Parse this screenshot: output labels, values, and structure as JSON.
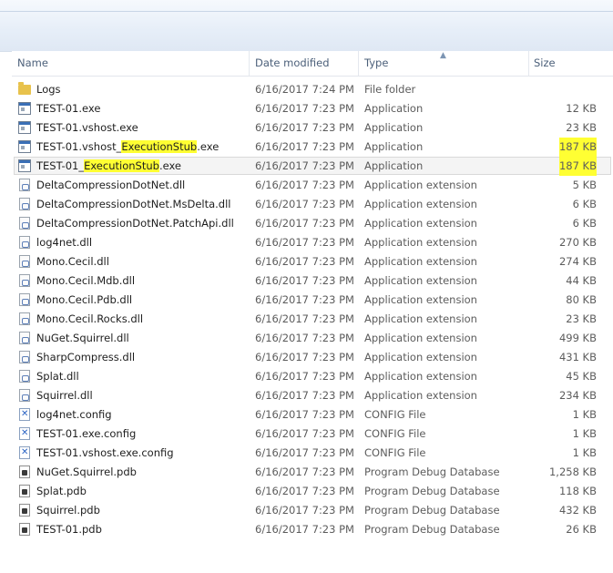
{
  "columns": {
    "name": "Name",
    "date_modified": "Date modified",
    "type": "Type",
    "size": "Size"
  },
  "sort": {
    "column": "type",
    "direction": "ascending"
  },
  "highlight_color": "#ffff33",
  "files": [
    {
      "icon": "folder-icon",
      "name": "Logs",
      "date": "6/16/2017 7:24 PM",
      "type": "File folder",
      "size": ""
    },
    {
      "icon": "application-icon",
      "name": "TEST-01.exe",
      "date": "6/16/2017 7:23 PM",
      "type": "Application",
      "size": "12 KB"
    },
    {
      "icon": "application-icon",
      "name": "TEST-01.vshost.exe",
      "date": "6/16/2017 7:23 PM",
      "type": "Application",
      "size": "23 KB"
    },
    {
      "icon": "application-icon",
      "name_pre": "TEST-01.vshost_",
      "name_hl": "ExecutionStub",
      "name_post": ".exe",
      "date": "6/16/2017 7:23 PM",
      "type": "Application",
      "size": "187 KB",
      "size_highlighted": true
    },
    {
      "icon": "application-icon",
      "name_pre": "TEST-01_",
      "name_hl": "ExecutionStub",
      "name_post": ".exe",
      "date": "6/16/2017 7:23 PM",
      "type": "Application",
      "size": "187 KB",
      "size_highlighted": true,
      "selected": true
    },
    {
      "icon": "dll-icon",
      "name": "DeltaCompressionDotNet.dll",
      "date": "6/16/2017 7:23 PM",
      "type": "Application extension",
      "size": "5 KB"
    },
    {
      "icon": "dll-icon",
      "name": "DeltaCompressionDotNet.MsDelta.dll",
      "date": "6/16/2017 7:23 PM",
      "type": "Application extension",
      "size": "6 KB"
    },
    {
      "icon": "dll-icon",
      "name": "DeltaCompressionDotNet.PatchApi.dll",
      "date": "6/16/2017 7:23 PM",
      "type": "Application extension",
      "size": "6 KB"
    },
    {
      "icon": "dll-icon",
      "name": "log4net.dll",
      "date": "6/16/2017 7:23 PM",
      "type": "Application extension",
      "size": "270 KB"
    },
    {
      "icon": "dll-icon",
      "name": "Mono.Cecil.dll",
      "date": "6/16/2017 7:23 PM",
      "type": "Application extension",
      "size": "274 KB"
    },
    {
      "icon": "dll-icon",
      "name": "Mono.Cecil.Mdb.dll",
      "date": "6/16/2017 7:23 PM",
      "type": "Application extension",
      "size": "44 KB"
    },
    {
      "icon": "dll-icon",
      "name": "Mono.Cecil.Pdb.dll",
      "date": "6/16/2017 7:23 PM",
      "type": "Application extension",
      "size": "80 KB"
    },
    {
      "icon": "dll-icon",
      "name": "Mono.Cecil.Rocks.dll",
      "date": "6/16/2017 7:23 PM",
      "type": "Application extension",
      "size": "23 KB"
    },
    {
      "icon": "dll-icon",
      "name": "NuGet.Squirrel.dll",
      "date": "6/16/2017 7:23 PM",
      "type": "Application extension",
      "size": "499 KB"
    },
    {
      "icon": "dll-icon",
      "name": "SharpCompress.dll",
      "date": "6/16/2017 7:23 PM",
      "type": "Application extension",
      "size": "431 KB"
    },
    {
      "icon": "dll-icon",
      "name": "Splat.dll",
      "date": "6/16/2017 7:23 PM",
      "type": "Application extension",
      "size": "45 KB"
    },
    {
      "icon": "dll-icon",
      "name": "Squirrel.dll",
      "date": "6/16/2017 7:23 PM",
      "type": "Application extension",
      "size": "234 KB"
    },
    {
      "icon": "config-icon",
      "name": "log4net.config",
      "date": "6/16/2017 7:23 PM",
      "type": "CONFIG File",
      "size": "1 KB"
    },
    {
      "icon": "config-icon",
      "name": "TEST-01.exe.config",
      "date": "6/16/2017 7:23 PM",
      "type": "CONFIG File",
      "size": "1 KB"
    },
    {
      "icon": "config-icon",
      "name": "TEST-01.vshost.exe.config",
      "date": "6/16/2017 7:23 PM",
      "type": "CONFIG File",
      "size": "1 KB"
    },
    {
      "icon": "pdb-icon",
      "name": "NuGet.Squirrel.pdb",
      "date": "6/16/2017 7:23 PM",
      "type": "Program Debug Database",
      "size": "1,258 KB"
    },
    {
      "icon": "pdb-icon",
      "name": "Splat.pdb",
      "date": "6/16/2017 7:23 PM",
      "type": "Program Debug Database",
      "size": "118 KB"
    },
    {
      "icon": "pdb-icon",
      "name": "Squirrel.pdb",
      "date": "6/16/2017 7:23 PM",
      "type": "Program Debug Database",
      "size": "432 KB"
    },
    {
      "icon": "pdb-icon",
      "name": "TEST-01.pdb",
      "date": "6/16/2017 7:23 PM",
      "type": "Program Debug Database",
      "size": "26 KB"
    }
  ]
}
